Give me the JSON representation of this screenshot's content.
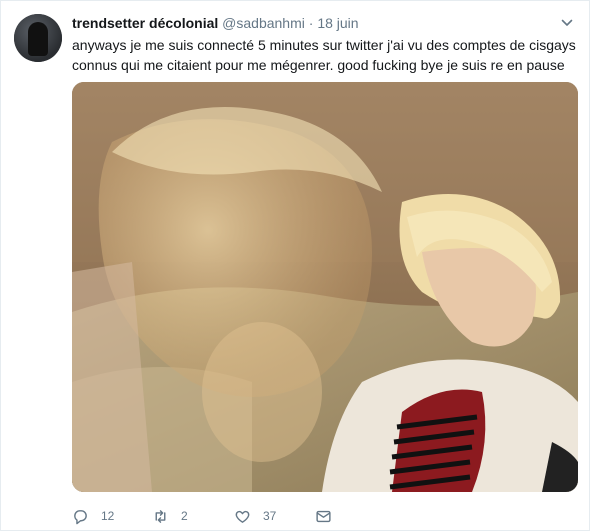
{
  "tweet": {
    "display_name": "trendsetter décolonial",
    "handle": "@sadbanhmi",
    "separator": "·",
    "time": "18 juin",
    "text": "anyways je me suis connecté 5 minutes sur twitter j'ai vu des comptes de cisgays connus qui me citaient pour me mégenrer. good fucking bye je suis re en pause",
    "actions": {
      "reply_count": "12",
      "retweet_count": "2",
      "like_count": "37"
    }
  },
  "colors": {
    "text": "#14171a",
    "secondary": "#657786",
    "border": "#e6ecf0"
  }
}
